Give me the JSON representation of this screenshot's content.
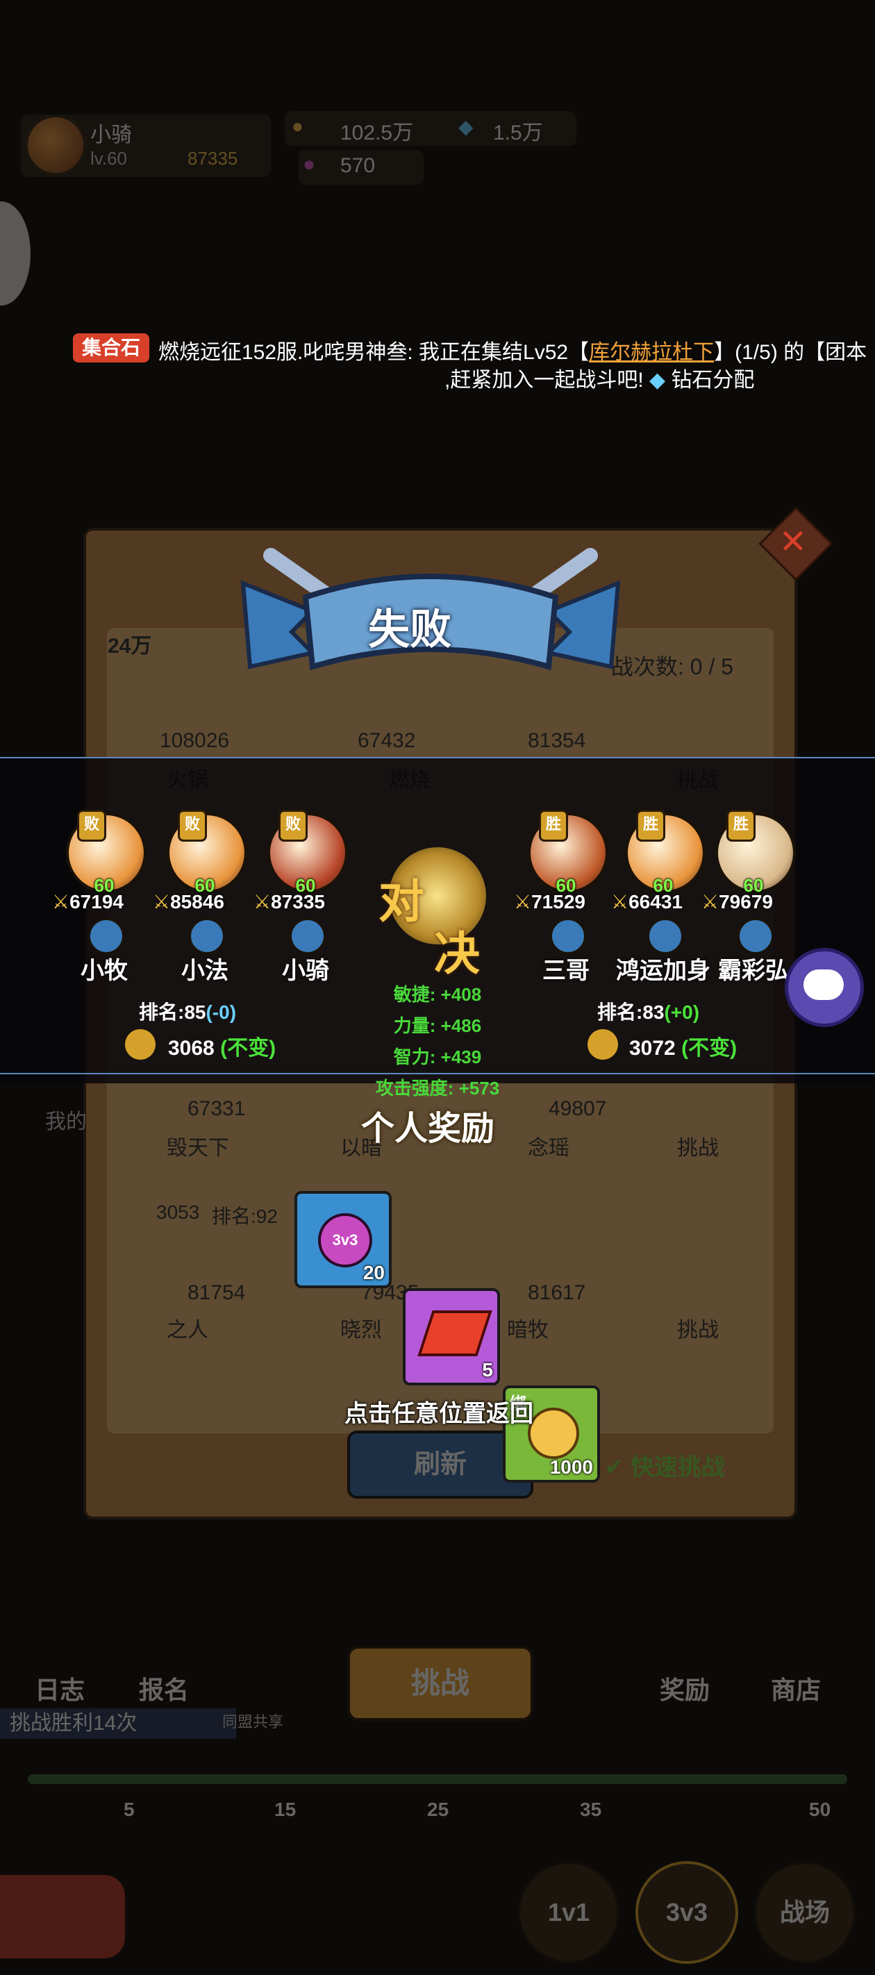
{
  "player": {
    "name": "小骑",
    "level": "lv.60",
    "power": "87335",
    "bound_gold": "102.5万",
    "bound_diamond": "1.5万",
    "currency3": "570"
  },
  "chat": {
    "tag": "集合石",
    "message_prefix": "燃烧远征152服.叱咤男神叁: 我正在集结Lv52【",
    "boss_name": "库尔赫拉杜下",
    "message_suffix": "】(1/5) 的【团本",
    "message_line2": ",赶紧加入一起战斗吧!",
    "diamond_share": "钻石分配"
  },
  "background": {
    "power_header": "24万",
    "challenge_count": "战次数: 0 / 5",
    "row1": [
      {
        "power": "108026",
        "name": "火锅"
      },
      {
        "power": "67432",
        "name": "燃烧"
      },
      {
        "power": "81354",
        "name": ""
      }
    ],
    "row2": [
      {
        "power": "67331",
        "name": "毁天下"
      },
      {
        "power": "",
        "name": "以暗"
      },
      {
        "power": "49807",
        "name": "念瑶"
      }
    ],
    "row3_rank": "3053",
    "row3_rank_label": "排名:92",
    "row3": [
      {
        "power": "81754",
        "name": "之人"
      },
      {
        "power": "79435",
        "name": "晓烈"
      },
      {
        "power": "81617",
        "name": "暗牧"
      }
    ],
    "challenge_label": "挑战",
    "refresh_label": "刷新",
    "quick_challenge": "快速挑战",
    "bottom_nav": {
      "log": "日志",
      "signup": "报名",
      "challenge": "挑战",
      "reward": "奖励",
      "shop": "商店"
    },
    "win_count": "挑战胜利14次",
    "milestones": [
      "5",
      "15",
      "25",
      "35",
      "50"
    ],
    "modes": [
      "1v1",
      "3v3",
      "战场"
    ],
    "share": "同盟共享"
  },
  "result": {
    "title": "失败",
    "versus": "对决",
    "left_team": [
      {
        "badge": "败",
        "level": "60",
        "power": "67194",
        "name": "小牧",
        "color": "#e8943c"
      },
      {
        "badge": "败",
        "level": "60",
        "power": "85846",
        "name": "小法",
        "color": "#e8943c"
      },
      {
        "badge": "败",
        "level": "60",
        "power": "87335",
        "name": "小骑",
        "color": "#b8462a"
      }
    ],
    "right_team": [
      {
        "badge": "胜",
        "level": "60",
        "power": "71529",
        "name": "三哥",
        "color": "#c05a2a"
      },
      {
        "badge": "胜",
        "level": "60",
        "power": "66431",
        "name": "鸿运加身",
        "color": "#e8943c"
      },
      {
        "badge": "胜",
        "level": "60",
        "power": "79679",
        "name": "霸彩弘",
        "color": "#d8b88a"
      }
    ],
    "left_rank": "排名:85",
    "left_rank_change": "(-0)",
    "left_score": "3068",
    "left_score_change": "(不变)",
    "right_rank": "排名:83",
    "right_rank_change": "(+0)",
    "right_score": "3072",
    "right_score_change": "(不变)",
    "stats": [
      "敏捷: +408",
      "力量: +486",
      "智力: +439",
      "攻击强度: +573"
    ],
    "rewards_title": "个人奖励",
    "rewards": [
      {
        "icon": "arena-token-icon",
        "count": "20",
        "bg": "#3a8fd0"
      },
      {
        "icon": "red-crystal-icon",
        "count": "5",
        "bg": "#b45ad8"
      },
      {
        "icon": "bound-gold-icon",
        "count": "1000",
        "bg": "#7ab83a",
        "tag": "绑"
      }
    ],
    "return_hint": "点击任意位置返回"
  }
}
